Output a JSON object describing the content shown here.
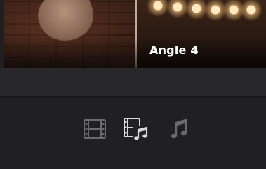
{
  "viewer": {
    "angle_label": "Angle 4"
  },
  "toolbar": {
    "buttons": [
      {
        "icon": "film-strip-icon",
        "state": "dim"
      },
      {
        "icon": "video-audio-icon",
        "state": "active"
      },
      {
        "icon": "music-note-icon",
        "state": "dim"
      }
    ]
  },
  "colors": {
    "background": "#1f1f21",
    "icon_active": "#d9d9d9",
    "icon_dim": "#6a6a6c",
    "label": "#ffffff"
  }
}
